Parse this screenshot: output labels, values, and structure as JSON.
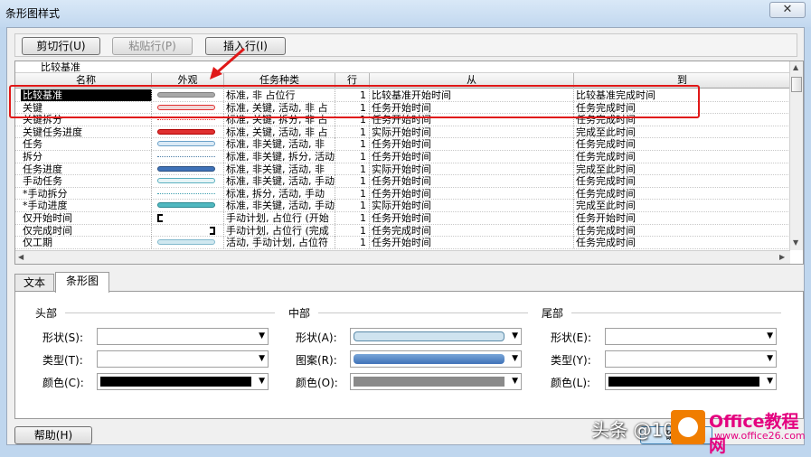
{
  "window": {
    "title": "条形图样式",
    "close_glyph": "✕"
  },
  "toolbar": {
    "cut_row": "剪切行(U)",
    "paste_row": "粘贴行(P)",
    "insert_row": "插入行(I)"
  },
  "edit_value": "比较基准",
  "columns": [
    "名称",
    "外观",
    "任务种类",
    "行",
    "从",
    "到"
  ],
  "rows": [
    {
      "name": "比较基准",
      "swatch": "#a8a8a8",
      "swatch_border": "#808080",
      "type": "标准, 非 占位行",
      "row": "1",
      "from": "比较基准开始时间",
      "to": "比较基准完成时间",
      "selected": true
    },
    {
      "name": "关键",
      "swatch": "#f2d6d6",
      "swatch_border": "#e03030",
      "type": "标准, 关键, 活动, 非 占",
      "row": "1",
      "from": "任务开始时间",
      "to": "任务完成时间"
    },
    {
      "name": "关键拆分",
      "swatch": "dotted",
      "swatch_border": "#e03030",
      "type": "标准, 关键, 拆分, 非 占",
      "row": "1",
      "from": "任务开始时间",
      "to": "任务完成时间"
    },
    {
      "name": "关键任务进度",
      "swatch": "#e03030",
      "swatch_border": "#b00000",
      "type": "标准, 关键, 活动, 非 占",
      "row": "1",
      "from": "实际开始时间",
      "to": "完成至此时间"
    },
    {
      "name": "任务",
      "swatch": "#dbeaf6",
      "swatch_border": "#6aa0c8",
      "type": "标准, 非关键, 活动, 非",
      "row": "1",
      "from": "任务开始时间",
      "to": "任务完成时间"
    },
    {
      "name": "拆分",
      "swatch": "dotted",
      "swatch_border": "#5080a8",
      "type": "标准, 非关键, 拆分, 活动",
      "row": "1",
      "from": "任务开始时间",
      "to": "任务完成时间"
    },
    {
      "name": "任务进度",
      "swatch": "#3f72b8",
      "swatch_border": "#2a4f80",
      "type": "标准, 非关键, 活动, 非",
      "row": "1",
      "from": "实际开始时间",
      "to": "完成至此时间"
    },
    {
      "name": "手动任务",
      "swatch": "#e6f4f6",
      "swatch_border": "#5ab0c0",
      "type": "标准, 非关键, 活动, 手动",
      "row": "1",
      "from": "任务开始时间",
      "to": "任务完成时间"
    },
    {
      "name": "*手动拆分",
      "swatch": "dotted",
      "swatch_border": "#40a0b0",
      "type": "标准, 拆分, 活动, 手动",
      "row": "1",
      "from": "任务开始时间",
      "to": "任务完成时间"
    },
    {
      "name": "*手动进度",
      "swatch": "#50b8c0",
      "swatch_border": "#2a8890",
      "type": "标准, 非关键, 活动, 手动",
      "row": "1",
      "from": "实际开始时间",
      "to": "完成至此时间"
    },
    {
      "name": "仅开始时间",
      "swatch": "bracket-left",
      "swatch_border": "#000000",
      "type": "手动计划, 占位行 (开始",
      "row": "1",
      "from": "任务开始时间",
      "to": "任务开始时间"
    },
    {
      "name": "仅完成时间",
      "swatch": "bracket-right",
      "swatch_border": "#000000",
      "type": "手动计划, 占位行 (完成",
      "row": "1",
      "from": "任务完成时间",
      "to": "任务完成时间"
    },
    {
      "name": "仅工期",
      "swatch": "#d0e8f0",
      "swatch_border": "#80b8cc",
      "type": "活动, 手动计划, 占位符",
      "row": "1",
      "from": "任务开始时间",
      "to": "任务完成时间"
    }
  ],
  "tabs": [
    "文本",
    "条形图"
  ],
  "groups": {
    "head": {
      "title": "头部",
      "shape": "形状(S):",
      "type": "类型(T):",
      "color": "颜色(C):",
      "color_value": "#000000"
    },
    "middle": {
      "title": "中部",
      "shape": "形状(A):",
      "pattern": "图案(R):",
      "color": "颜色(O):",
      "shape_swatch": "#cfe3ef",
      "pattern_swatch": "#3f72b8",
      "color_value": "#8a8a8a"
    },
    "tail": {
      "title": "尾部",
      "shape": "形状(E):",
      "type": "类型(Y):",
      "color": "颜色(L):",
      "color_value": "#000000"
    }
  },
  "buttons": {
    "help": "帮助(H)",
    "ok": "确定"
  },
  "watermark": {
    "text1": "头条 @10",
    "text2": "Office教程网",
    "text3": "www.office26.com"
  },
  "colors": {
    "highlight": "#e01818",
    "selected_bg": "#000000",
    "logo": "#f07d00",
    "brand": "#e4007f"
  }
}
